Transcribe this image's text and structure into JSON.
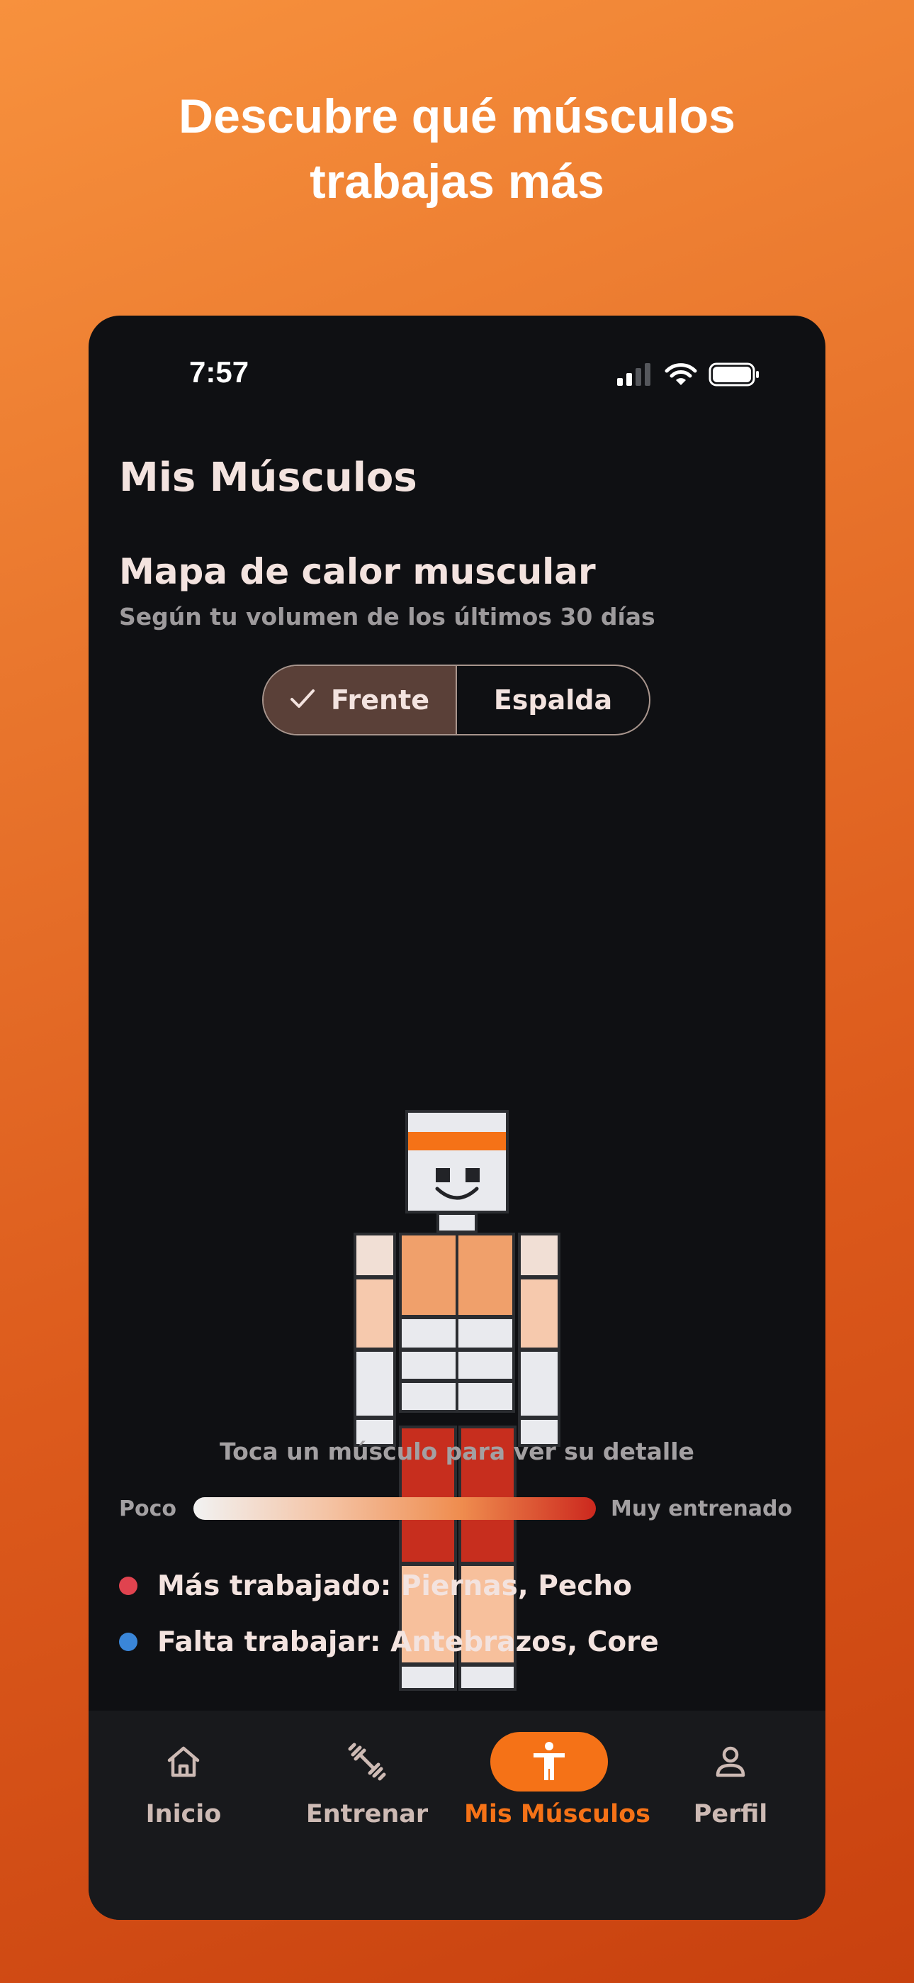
{
  "promo": {
    "headline_line1": "Descubre qué músculos",
    "headline_line2": "trabajas más"
  },
  "status_bar": {
    "time": "7:57",
    "icons": [
      "cellular-signal-icon",
      "wifi-icon",
      "battery-icon"
    ]
  },
  "screen": {
    "title": "Mis Músculos",
    "section_title": "Mapa de calor muscular",
    "section_subtitle": "Según tu volumen de los últimos 30 días"
  },
  "view_toggle": {
    "options": [
      {
        "label": "Frente",
        "selected": true
      },
      {
        "label": "Espalda",
        "selected": false
      }
    ]
  },
  "heatmap": {
    "view": "Frente",
    "muscle_colors": {
      "head": "#e9eaee",
      "headband": "#f57217",
      "shoulders": "#f1dfd5",
      "biceps": "#f6c9ad",
      "forearms": "#e9eaee",
      "hands": "#e9eaee",
      "chest": "#f0a06b",
      "abs": "#e9eaee",
      "quads": "#c72e1e",
      "calves": "#f7c09c",
      "feet": "#e9eaee",
      "outline": "#2b2d31"
    }
  },
  "hint": "Toca un músculo para ver su detalle",
  "legend": {
    "low_label": "Poco",
    "high_label": "Muy entrenado",
    "gradient": [
      "#f2f2f2",
      "#f4c3a4",
      "#ef8c4e",
      "#cc281e"
    ]
  },
  "insights": [
    {
      "label": "Más trabajado: Piernas, Pecho",
      "dot_color": "#e0434f"
    },
    {
      "label": "Falta trabajar: Antebrazos, Core",
      "dot_color": "#3a86d8"
    }
  ],
  "tab_bar": {
    "accent": "#f57217",
    "tabs": [
      {
        "label": "Inicio",
        "icon": "home-icon",
        "active": false
      },
      {
        "label": "Entrenar",
        "icon": "dumbbell-icon",
        "active": false
      },
      {
        "label": "Mis Músculos",
        "icon": "accessibility-icon",
        "active": true
      },
      {
        "label": "Perfil",
        "icon": "person-icon",
        "active": false
      }
    ]
  }
}
